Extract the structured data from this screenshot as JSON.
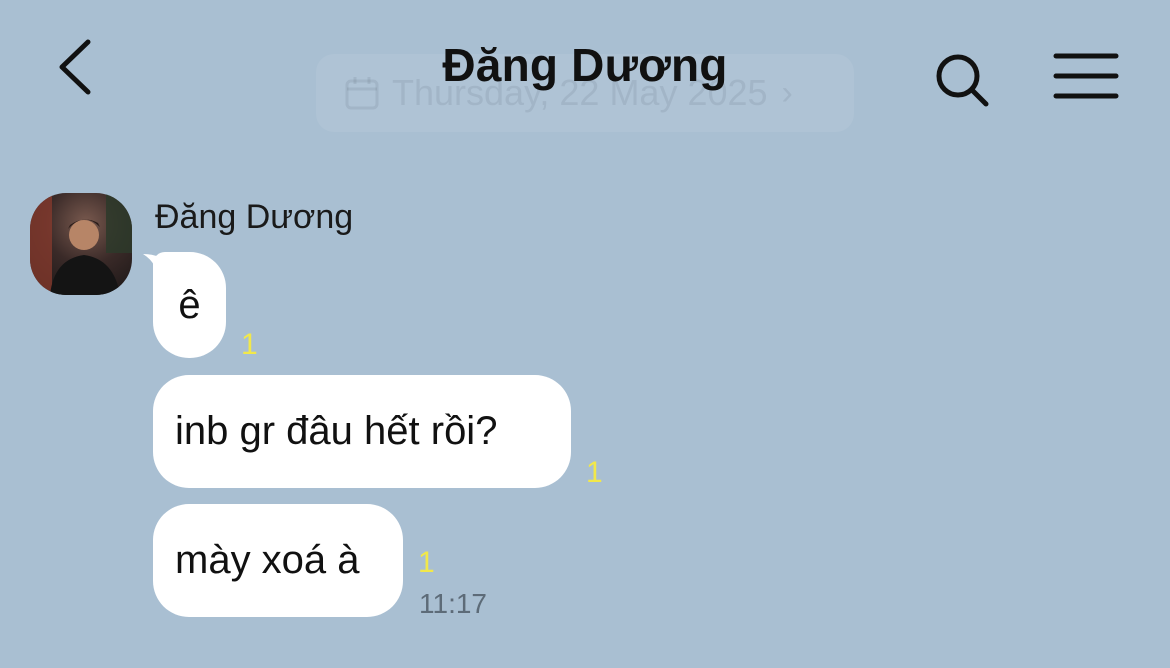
{
  "header": {
    "title": "Đăng Dương",
    "back_icon": "chevron-left-icon",
    "search_icon": "search-icon",
    "menu_icon": "hamburger-menu-icon"
  },
  "date_pill": {
    "label": "Thursday, 22 May 2025",
    "icon": "calendar-icon",
    "chevron": "›"
  },
  "conversation": {
    "sender_name": "Đăng Dương",
    "messages": [
      {
        "text": "ê",
        "unread_count": "1"
      },
      {
        "text": "inb gr đâu hết rồi?",
        "unread_count": "1"
      },
      {
        "text": "mày xoá à",
        "unread_count": "1",
        "time": "11:17"
      }
    ]
  },
  "colors": {
    "background": "#a9bfd2",
    "bubble": "#ffffff",
    "unread": "#f2e84a",
    "time": "#5d6b78"
  }
}
